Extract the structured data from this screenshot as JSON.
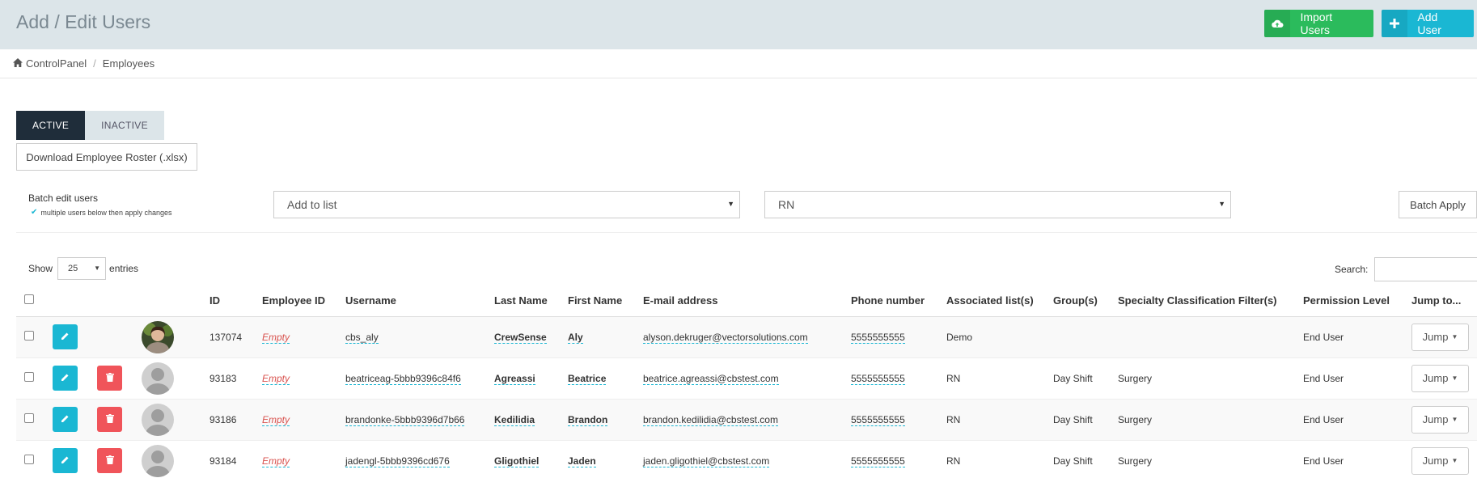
{
  "header": {
    "title": "Add / Edit Users",
    "import_label": "Import Users",
    "add_label": "Add User",
    "import_color": "#2bbb5c",
    "add_color": "#1ab7d3"
  },
  "breadcrumb": {
    "home": "ControlPanel",
    "current": "Employees"
  },
  "tabs": [
    {
      "label": "ACTIVE"
    },
    {
      "label": "INACTIVE"
    }
  ],
  "roster_button": "Download Employee Roster (.xlsx)",
  "batch": {
    "label": "Batch edit users",
    "hint": "multiple users below then apply changes",
    "action_value": "Add to list",
    "target_value": "RN",
    "apply_label": "Batch Apply"
  },
  "table_controls": {
    "show_label": "Show",
    "entries_value": "25",
    "entries_label": "entries",
    "search_label": "Search:"
  },
  "columns": [
    "ID",
    "Employee ID",
    "Username",
    "Last Name",
    "First Name",
    "E-mail address",
    "Phone number",
    "Associated list(s)",
    "Group(s)",
    "Specialty Classification Filter(s)",
    "Permission Level",
    "Jump to..."
  ],
  "rows": [
    {
      "id": "137074",
      "employee_id": "Empty",
      "username": "cbs_aly",
      "last_name": "CrewSense",
      "first_name": "Aly",
      "email": "alyson.dekruger@vectorsolutions.com",
      "phone": "5555555555",
      "lists": "Demo",
      "groups": "",
      "specialty": "",
      "permission": "End User",
      "jump": "Jump"
    },
    {
      "id": "93183",
      "employee_id": "Empty",
      "username": "beatriceag-5bbb9396c84f6",
      "last_name": "Agreassi",
      "first_name": "Beatrice",
      "email": "beatrice.agreassi@cbstest.com",
      "phone": "5555555555",
      "lists": "RN",
      "groups": "Day Shift",
      "specialty": "Surgery",
      "permission": "End User",
      "jump": "Jump"
    },
    {
      "id": "93186",
      "employee_id": "Empty",
      "username": "brandonke-5bbb9396d7b66",
      "last_name": "Kedilidia",
      "first_name": "Brandon",
      "email": "brandon.kedilidia@cbstest.com",
      "phone": "5555555555",
      "lists": "RN",
      "groups": "Day Shift",
      "specialty": "Surgery",
      "permission": "End User",
      "jump": "Jump"
    },
    {
      "id": "93184",
      "employee_id": "Empty",
      "username": "jadengl-5bbb9396cd676",
      "last_name": "Gligothiel",
      "first_name": "Jaden",
      "email": "jaden.gligothiel@cbstest.com",
      "phone": "5555555555",
      "lists": "RN",
      "groups": "Day Shift",
      "specialty": "Surgery",
      "permission": "End User",
      "jump": "Jump"
    }
  ]
}
